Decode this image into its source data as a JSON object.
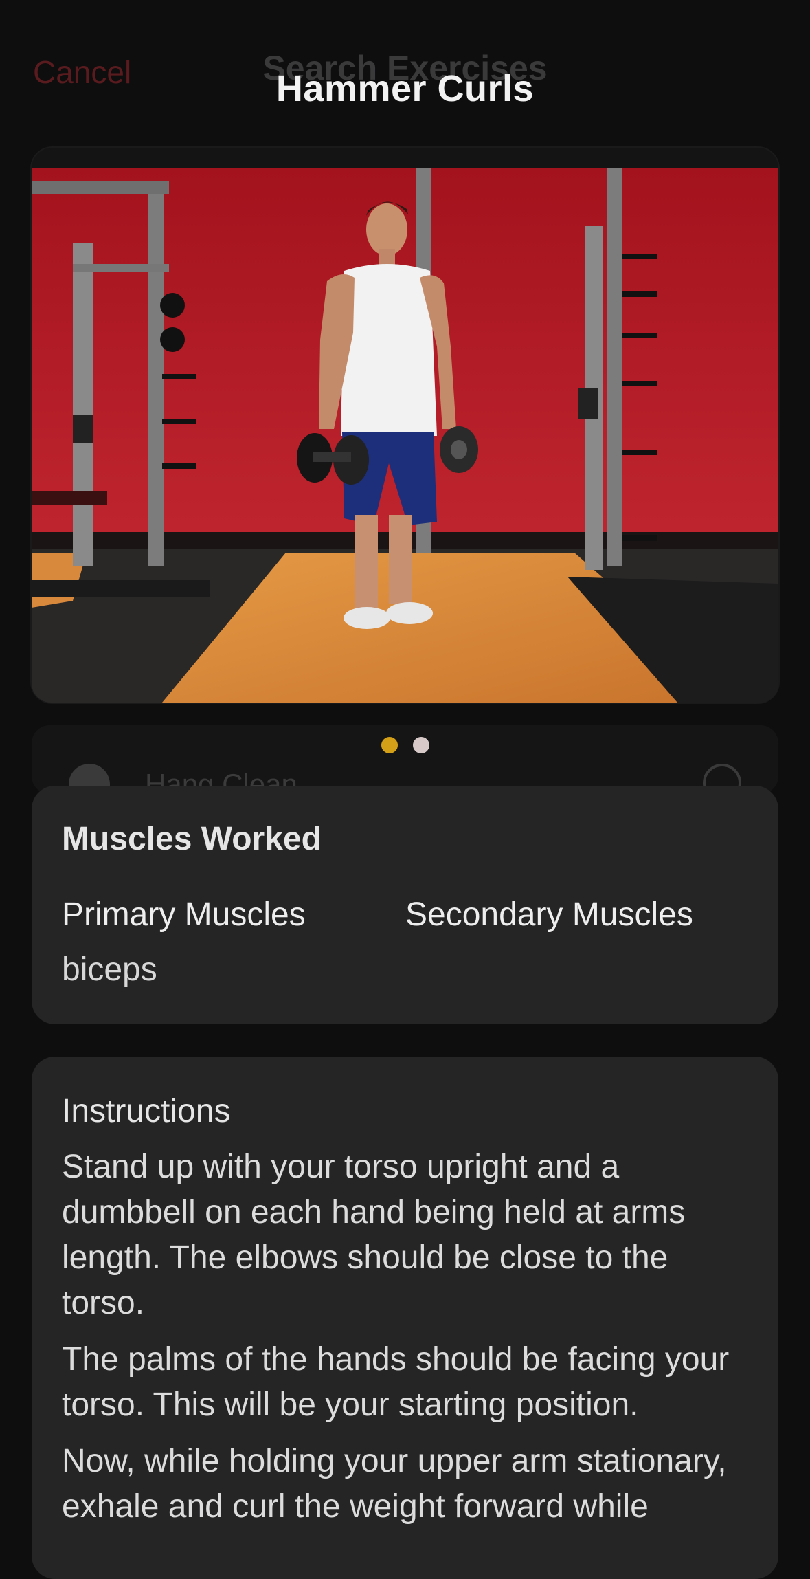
{
  "background_screen": {
    "cancel_label": "Cancel",
    "title": "Search Exercises",
    "row_label": "Hang Clean"
  },
  "modal": {
    "title": "Hammer Curls",
    "carousel": {
      "total": 2,
      "active_index": 0,
      "active_color": "#d4a017",
      "inactive_color": "#d8c9c9"
    },
    "muscles": {
      "heading": "Muscles Worked",
      "primary_label": "Primary Muscles",
      "secondary_label": "Secondary Muscles",
      "primary_value": "biceps",
      "secondary_value": ""
    },
    "instructions": {
      "heading": "Instructions",
      "steps": [
        "Stand up with your torso upright and a dumbbell on each hand being held at arms length. The elbows should be close to the torso.",
        "The palms of the hands should be facing your torso. This will be your starting position.",
        "Now, while holding your upper arm stationary, exhale and curl the weight forward while"
      ]
    }
  },
  "colors": {
    "background": "#0e0e0f",
    "card": "#252526",
    "wall": "#b81d2a",
    "floor": "#d98a3a"
  }
}
